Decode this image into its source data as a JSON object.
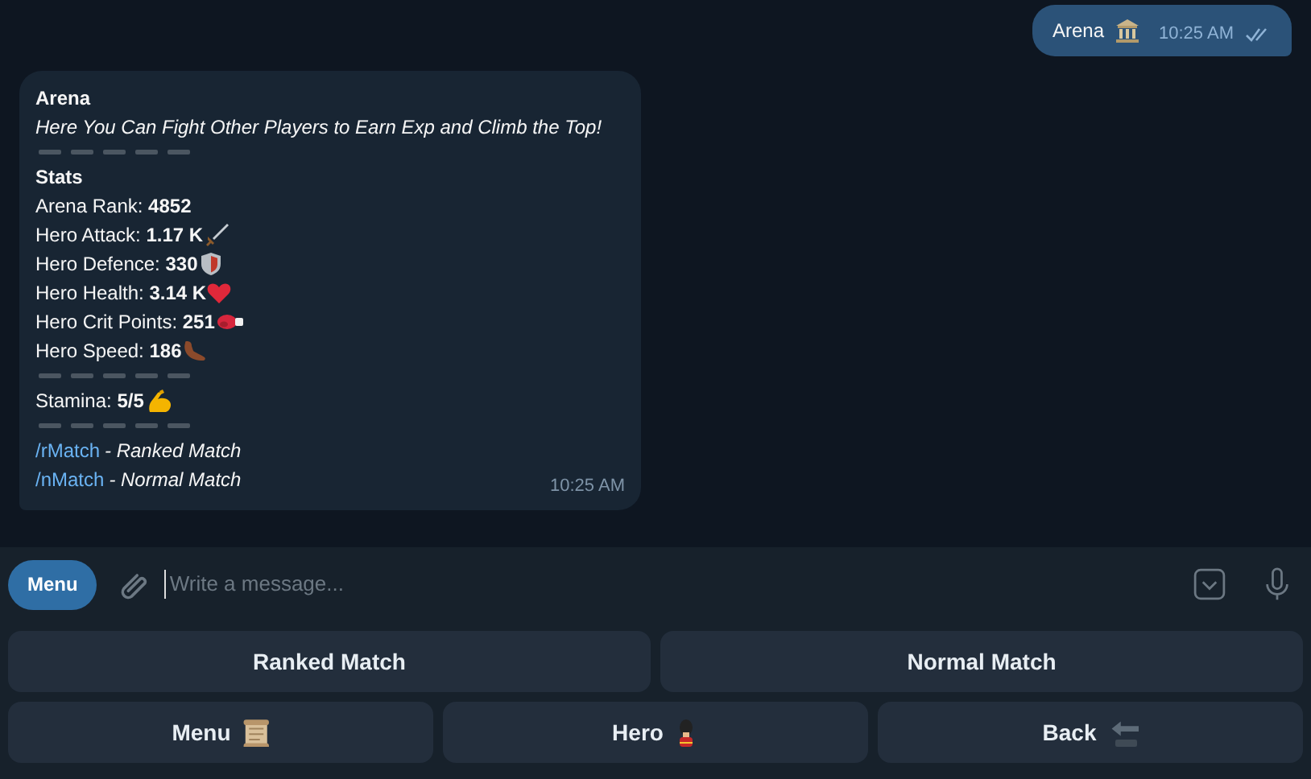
{
  "outgoing": {
    "text": "Arena",
    "time": "10:25 AM",
    "read": true
  },
  "incoming": {
    "time": "10:25 AM",
    "lines": [
      {
        "kind": "title",
        "text": "Arena"
      },
      {
        "kind": "italic",
        "text": "Here You Can Fight Other Players to Earn Exp and Climb the Top!"
      },
      {
        "kind": "divider"
      },
      {
        "kind": "title",
        "text": "Stats"
      },
      {
        "kind": "stat",
        "text": "Arena Rank: **4852**"
      },
      {
        "kind": "stat",
        "text": "Hero Attack: **1.17 K**"
      },
      {
        "kind": "stat",
        "text": "Hero Defence: **330**"
      },
      {
        "kind": "stat",
        "text": "Hero Health: **3.14 K**"
      },
      {
        "kind": "stat",
        "text": "Hero Crit Points: **251**"
      },
      {
        "kind": "stat",
        "text": "Hero Speed: **186**"
      },
      {
        "kind": "divider"
      },
      {
        "kind": "stat",
        "text": "Stamina: **5/5**"
      },
      {
        "kind": "divider"
      },
      {
        "kind": "command",
        "command": "/rMatch",
        "text": "- Ranked Match"
      },
      {
        "kind": "command",
        "command": "/nMatch",
        "text": "- Normal Match"
      }
    ]
  },
  "composer": {
    "menu_button": "Menu",
    "placeholder": "Write a message..."
  },
  "keyboard": [
    [
      "Ranked Match",
      "Normal Match"
    ],
    [
      "Menu",
      "Hero",
      "Back"
    ]
  ]
}
